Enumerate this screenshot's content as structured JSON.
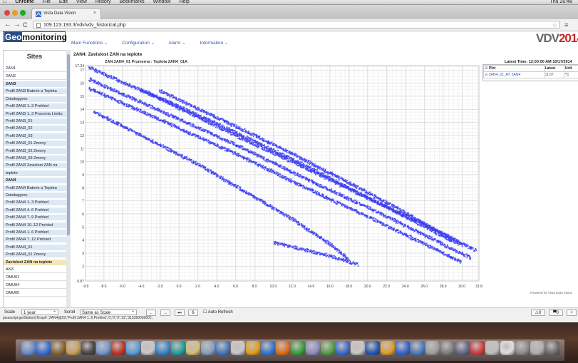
{
  "menubar": {
    "apple": "",
    "app": "Chrome",
    "items": [
      "File",
      "Edit",
      "View",
      "History",
      "Bookmarks",
      "Window",
      "Help"
    ],
    "clock": "Thu 20:48"
  },
  "browser": {
    "tab_title": "Vista Data Vision",
    "tab_close": "×",
    "back": "←",
    "forward": "→",
    "reload": "C",
    "url": "109.123.193.3/vdv/vdv_historical.php",
    "star": "☆",
    "menu": "≡"
  },
  "header": {
    "logo_a": "Geo",
    "logo_b": "monitoring",
    "brand_a": "VDV",
    "brand_b": "2014",
    "nav": [
      "Main Functions ⌄",
      "Configuration ⌄",
      "Alarm ⌄",
      "Information ⌄"
    ]
  },
  "sidebar": {
    "title": "Sites",
    "items": [
      {
        "label": "2AN1",
        "kind": "site"
      },
      {
        "label": "2AN2",
        "kind": "site"
      },
      {
        "label": "2AN3",
        "kind": "header"
      },
      {
        "label": "Profil 2AN3 Baterie a Teplota",
        "kind": "item"
      },
      {
        "label": "Dataloggeru",
        "kind": "item"
      },
      {
        "label": "Profil 2AN3 1..3 Prehled",
        "kind": "item"
      },
      {
        "label": "Profil 2AN3 1..3 Procenta Limitu",
        "kind": "item"
      },
      {
        "label": "Profil 2AN3_01",
        "kind": "item"
      },
      {
        "label": "Profil 2AN3_02",
        "kind": "item"
      },
      {
        "label": "Profil 2AN3_03",
        "kind": "item"
      },
      {
        "label": "Profil 2AN3_01 Zmeny",
        "kind": "item"
      },
      {
        "label": "Profil 2AN3_02 Zmeny",
        "kind": "item"
      },
      {
        "label": "Profil 2AN3_03 Zmeny",
        "kind": "item"
      },
      {
        "label": "Profil 2AN3 Zavislost ZAN na",
        "kind": "item"
      },
      {
        "label": "teplote",
        "kind": "item"
      },
      {
        "label": "2AN4",
        "kind": "header"
      },
      {
        "label": "Profil 2AN4 Baterie a Teplota",
        "kind": "item"
      },
      {
        "label": "Dataloggeru",
        "kind": "item"
      },
      {
        "label": "Profil 2AN4 1..3 Prehled",
        "kind": "item"
      },
      {
        "label": "Profil 2AN4 4..6 Prehled",
        "kind": "item"
      },
      {
        "label": "Profil 2AN4 7..9 Prehled",
        "kind": "item"
      },
      {
        "label": "Profil 2AN4 10..12 Prehled",
        "kind": "item"
      },
      {
        "label": "Profil 2AN4 1..6 Prehled",
        "kind": "item"
      },
      {
        "label": "Profil 2AN4 7..12 Prehled",
        "kind": "item"
      },
      {
        "label": "Profil 2AN4_01",
        "kind": "item"
      },
      {
        "label": "Profil 2AN4_01 Zmeny",
        "kind": "item"
      },
      {
        "label": "Zavislost ZAN na teplote",
        "kind": "selected"
      },
      {
        "label": "AN3",
        "kind": "site"
      },
      {
        "label": "OMU01",
        "kind": "site"
      },
      {
        "label": "OMU04",
        "kind": "site"
      },
      {
        "label": "OMU05",
        "kind": "site"
      }
    ]
  },
  "chart_header": {
    "title": "2AN4: Zavislost ZAN na teplote",
    "subtitle": "ZAN 2AN4_01 Prumerna : Teplota 2AN4_01A",
    "latest_time": "Latest Time: 12:00:00 AM 10/17/2014"
  },
  "legend": {
    "headers": [
      "Plot",
      "Latest",
      "Unit"
    ],
    "rows": [
      {
        "plot": "2AN4_01_AT: 2AN4",
        "latest": "11.87",
        "unit": "°C"
      }
    ]
  },
  "powered_by": "Powered by Vista Data Vision",
  "bottom": {
    "scale_label": "Scale",
    "scale_value": "1 year",
    "scroll_label": "Scroll",
    "scroll_value": "Same as Scale",
    "prev": "←",
    "next": "→",
    "last": "⏭",
    "page": "6",
    "auto_refresh": "Auto Refresh",
    "alarm_count": "0",
    "msg_count": "0",
    "plus": "+",
    "js_line": "javascript:getStation('Graph','2AN4@29','Profil 2AN4 1..6 Prehled','0','0','0','32','31536000000');"
  },
  "colors": {
    "series": "#3b3ef0",
    "accent_red": "#c62828",
    "nav_blue": "#2a57b0",
    "selected_bg": "#f3e7b8"
  },
  "chart_data": {
    "type": "scatter",
    "title": "ZAN 2AN4_01 Prumerna : Teplota 2AN4_01A",
    "xlim": [
      -9.9,
      31.8
    ],
    "ylim": [
      0.87,
      17.34
    ],
    "x_ticks": [
      "-9.9",
      "-8.0",
      "-6.0",
      "-4.0",
      "-2.0",
      "0.0",
      "2.0",
      "4.0",
      "6.0",
      "8.0",
      "10.0",
      "12.0",
      "14.0",
      "16.0",
      "18.0",
      "20.0",
      "22.0",
      "24.0",
      "26.0",
      "28.0",
      "30.0",
      "31.8"
    ],
    "y_ticks": [
      "0.87",
      "2",
      "3",
      "4",
      "5",
      "6",
      "7",
      "8",
      "9",
      "10",
      "11",
      "12",
      "13",
      "14",
      "15",
      "16",
      "17",
      "17.34"
    ],
    "grid": true,
    "series": [
      {
        "points": [
          [
            -9.5,
            17.2
          ],
          [
            -2,
            14.8
          ],
          [
            6,
            12.0
          ],
          [
            14,
            9.3
          ],
          [
            20,
            7.2
          ],
          [
            26,
            5.2
          ],
          [
            31.5,
            3.2
          ]
        ]
      },
      {
        "points": [
          [
            -9.5,
            16.3
          ],
          [
            -2,
            13.9
          ],
          [
            6,
            11.3
          ],
          [
            14,
            8.5
          ],
          [
            20,
            6.5
          ],
          [
            26,
            4.4
          ],
          [
            31,
            2.6
          ]
        ]
      },
      {
        "points": [
          [
            -9.5,
            15.6
          ],
          [
            -2,
            13.2
          ],
          [
            6,
            10.6
          ],
          [
            14,
            7.8
          ],
          [
            20,
            5.8
          ],
          [
            26,
            3.7
          ],
          [
            30,
            2.3
          ]
        ]
      },
      {
        "points": [
          [
            -4,
            15.5
          ],
          [
            4,
            12.9
          ],
          [
            12,
            10.2
          ],
          [
            18,
            8.0
          ],
          [
            24,
            5.8
          ],
          [
            29,
            3.9
          ]
        ]
      },
      {
        "points": [
          [
            -2,
            15.4
          ],
          [
            6,
            12.7
          ],
          [
            12,
            10.6
          ],
          [
            18,
            8.4
          ],
          [
            24,
            6.1
          ],
          [
            30,
            3.6
          ]
        ]
      },
      {
        "points": [
          [
            -9,
            13.8
          ],
          [
            -4,
            12.0
          ],
          [
            2,
            9.8
          ],
          [
            8,
            7.3
          ],
          [
            12,
            5.6
          ],
          [
            16,
            3.7
          ],
          [
            18,
            2.5
          ]
        ]
      },
      {
        "points": [
          [
            10,
            3.8
          ],
          [
            13,
            3.3
          ],
          [
            16,
            2.8
          ],
          [
            19,
            2.1
          ]
        ]
      }
    ]
  }
}
